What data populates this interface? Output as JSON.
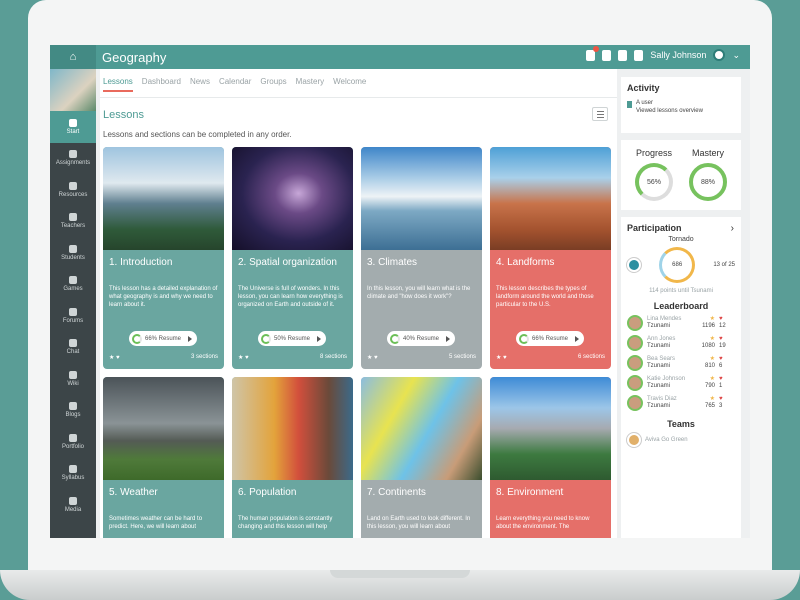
{
  "app": {
    "course_title": "Geography",
    "user_name": "Sally Johnson"
  },
  "colors": {
    "primary": "#4e9b94",
    "accent": "#e96a5d",
    "sidebar": "#3c4548",
    "teal_card": "#6aa6a0",
    "gray_card": "#a3acae",
    "coral_card": "#e56f69"
  },
  "sidebar": {
    "items": [
      {
        "label": "Start",
        "icon": "navigation-arrow-icon"
      },
      {
        "label": "Assignments",
        "icon": "assignment-icon"
      },
      {
        "label": "Resources",
        "icon": "folder-icon"
      },
      {
        "label": "Teachers",
        "icon": "person-icon"
      },
      {
        "label": "Students",
        "icon": "people-icon"
      },
      {
        "label": "Games",
        "icon": "gamepad-icon"
      },
      {
        "label": "Forums",
        "icon": "forum-icon"
      },
      {
        "label": "Chat",
        "icon": "chat-icon"
      },
      {
        "label": "Wiki",
        "icon": "wiki-icon"
      },
      {
        "label": "Blogs",
        "icon": "blog-icon"
      },
      {
        "label": "Portfolio",
        "icon": "portfolio-icon"
      },
      {
        "label": "Syllabus",
        "icon": "info-icon"
      },
      {
        "label": "Media",
        "icon": "media-icon"
      }
    ]
  },
  "tabs": [
    "Lessons",
    "Dashboard",
    "News",
    "Calendar",
    "Groups",
    "Mastery",
    "Welcome"
  ],
  "main": {
    "heading": "Lessons",
    "subtitle": "Lessons and sections can be completed in any order."
  },
  "lessons": [
    {
      "title": "1. Introduction",
      "desc": "This lesson has a detailed explanation of what geography is and why we need to learn about it.",
      "resume": "66% Resume",
      "sections": "3 sections"
    },
    {
      "title": "2. Spatial organization",
      "desc": "The Universe is full of wonders. In this lesson, you can learn how everything is organized on Earth and outside of it.",
      "resume": "50% Resume",
      "sections": "8 sections"
    },
    {
      "title": "3. Climates",
      "desc": "In this lesson, you will learn what is the climate and \"how does it work\"?",
      "resume": "40% Resume",
      "sections": "5 sections"
    },
    {
      "title": "4. Landforms",
      "desc": "This lesson describes the types of landform around the world and those particular to the U.S.",
      "resume": "66% Resume",
      "sections": "6 sections"
    },
    {
      "title": "5. Weather",
      "desc": "Sometimes weather can be hard to predict. Here, we will learn about",
      "resume": "",
      "sections": ""
    },
    {
      "title": "6. Population",
      "desc": "The human population is constantly changing and this lesson will help",
      "resume": "",
      "sections": ""
    },
    {
      "title": "7. Continents",
      "desc": "Land on Earth used to look different. In this lesson, you will learn about",
      "resume": "",
      "sections": ""
    },
    {
      "title": "8. Environment",
      "desc": "Learn everything you need to know about the environment. The",
      "resume": "",
      "sections": ""
    }
  ],
  "activity": {
    "title": "Activity",
    "user": "A user",
    "action": "Viewed lessons overview"
  },
  "progress": {
    "label": "Progress",
    "value": "56%",
    "fraction": 0.56
  },
  "mastery": {
    "label": "Mastery",
    "value": "88%",
    "fraction": 0.88
  },
  "participation": {
    "title": "Participation",
    "level": "Tornado",
    "points": "686",
    "rank": "13 of 25",
    "points_until": "114 points until Tsunami"
  },
  "leaderboard": {
    "title": "Leaderboard",
    "rows": [
      {
        "name": "Lina Mendes",
        "level": "Tzunami",
        "points": "1196",
        "count": "12"
      },
      {
        "name": "Ann Jones",
        "level": "Tzunami",
        "points": "1080",
        "count": "19"
      },
      {
        "name": "Bea Sears",
        "level": "Tzunami",
        "points": "810",
        "count": "6"
      },
      {
        "name": "Katie Johnson",
        "level": "Tzunami",
        "points": "790",
        "count": "1"
      },
      {
        "name": "Travis Diaz",
        "level": "Tzunami",
        "points": "765",
        "count": "3"
      }
    ]
  },
  "teams": {
    "title": "Teams",
    "first": "Aviva Go Green"
  }
}
